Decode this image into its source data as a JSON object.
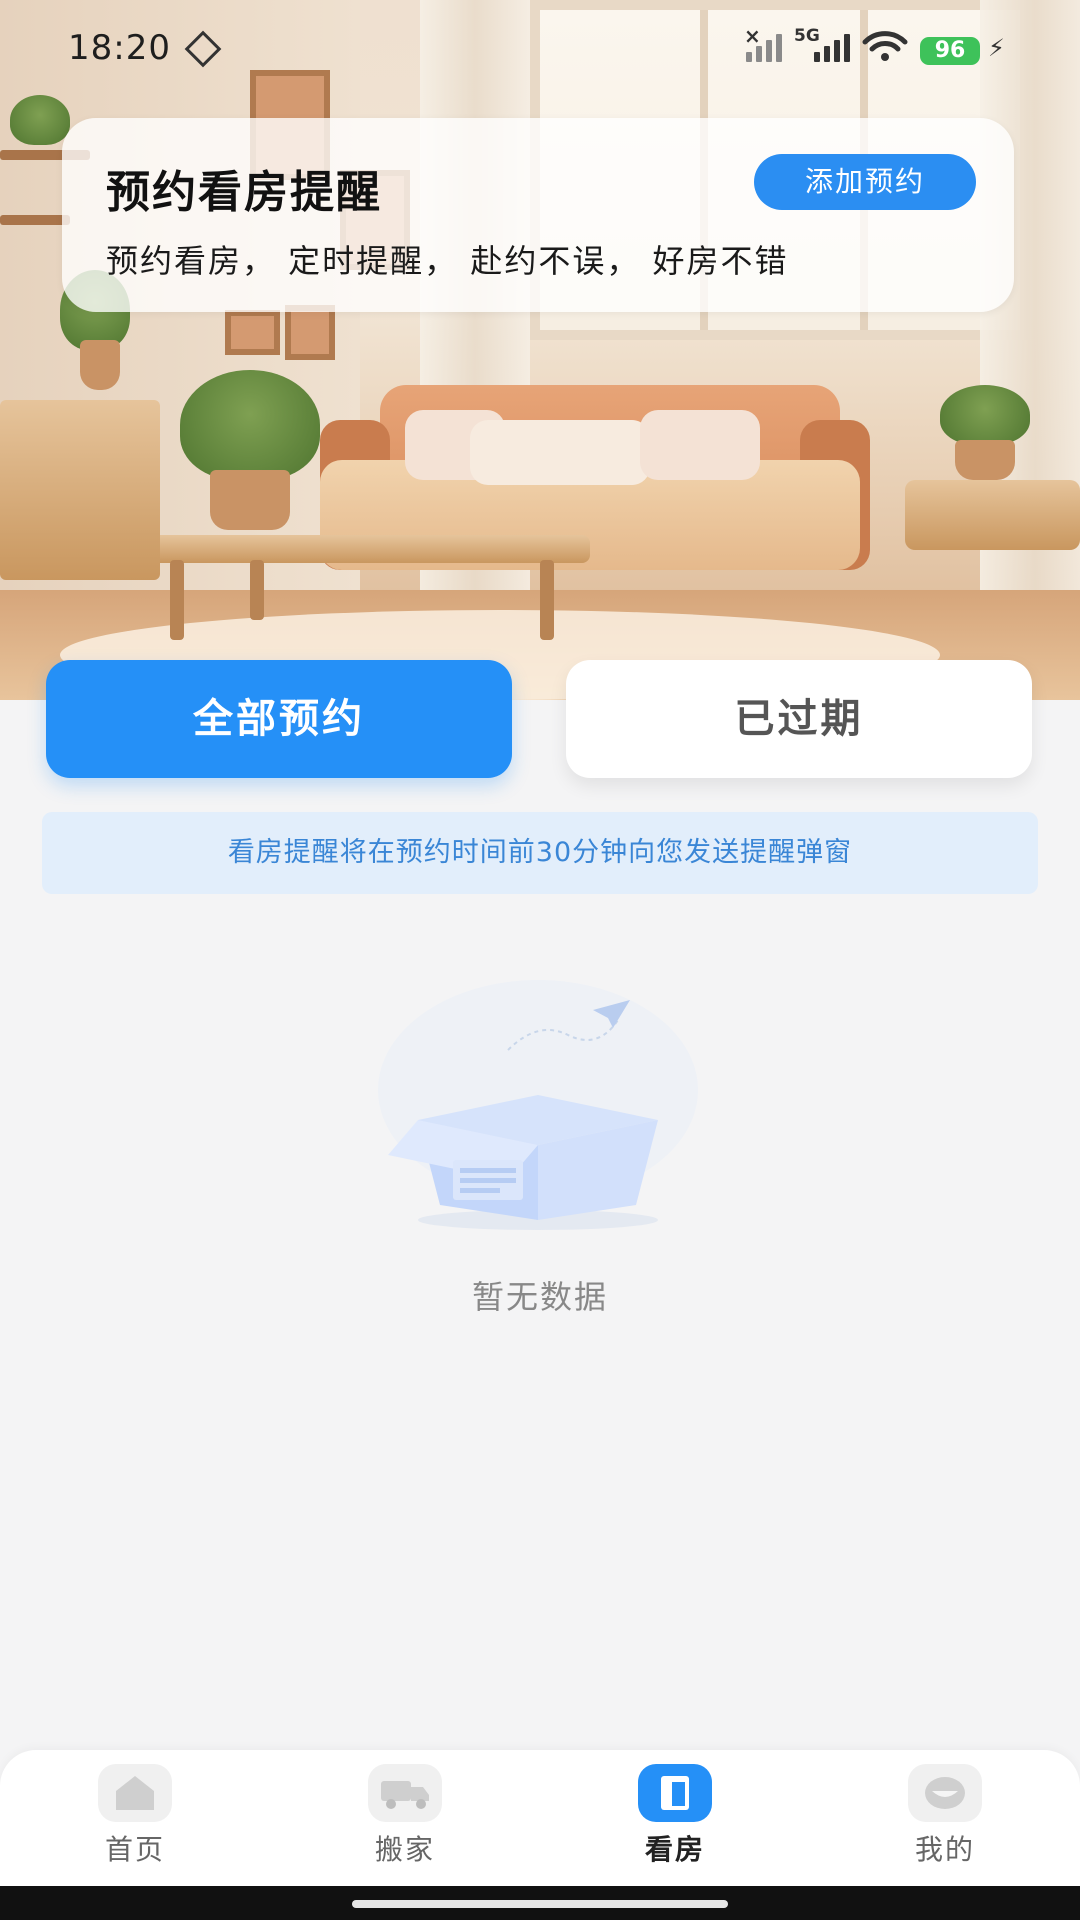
{
  "status_bar": {
    "time": "18:20",
    "network": "5G",
    "battery": "96",
    "icons": [
      "nfc-icon",
      "no-signal-icon",
      "signal-icon",
      "wifi-icon",
      "battery-icon",
      "charging-icon"
    ]
  },
  "reminder_card": {
    "title": "预约看房提醒",
    "subtitle": "预约看房， 定时提醒， 赴约不误， 好房不错",
    "add_button": "添加预约"
  },
  "tabs": [
    {
      "label": "全部预约",
      "active": true
    },
    {
      "label": "已过期",
      "active": false
    }
  ],
  "notice": "看房提醒将在预约时间前30分钟向您发送提醒弹窗",
  "empty_state": {
    "text": "暂无数据",
    "icon": "empty-box-icon"
  },
  "bottom_nav": [
    {
      "label": "首页",
      "icon": "home-icon",
      "active": false
    },
    {
      "label": "搬家",
      "icon": "truck-icon",
      "active": false
    },
    {
      "label": "看房",
      "icon": "door-icon",
      "active": true
    },
    {
      "label": "我的",
      "icon": "profile-icon",
      "active": false
    }
  ],
  "colors": {
    "primary": "#2590F7",
    "notice_bg": "#E2EEFB",
    "notice_text": "#3A86D6",
    "battery": "#3EC25A",
    "page_bg": "#F4F4F5"
  }
}
